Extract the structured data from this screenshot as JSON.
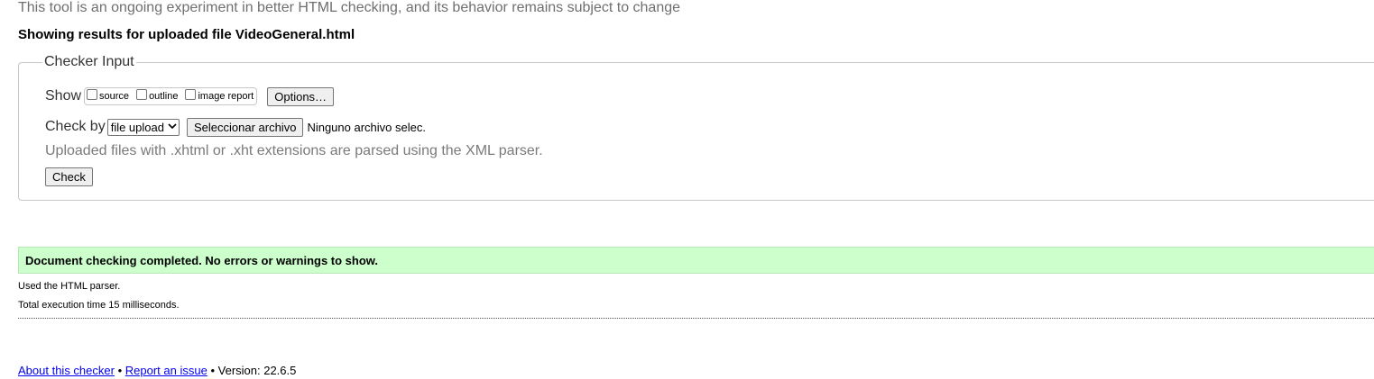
{
  "disclaimer": "This tool is an ongoing experiment in better HTML checking, and its behavior remains subject to change",
  "results_heading": "Showing results for uploaded file VideoGeneral.html",
  "checker_input": {
    "legend": "Checker Input",
    "show_label": "Show",
    "show_options": [
      {
        "label": "source",
        "checked": false
      },
      {
        "label": "outline",
        "checked": false
      },
      {
        "label": "image report",
        "checked": false
      }
    ],
    "options_button": "Options…",
    "check_by_label": "Check by",
    "check_by_selected": "file upload",
    "file_button": "Seleccionar archivo",
    "no_file_text": "Ninguno archivo selec.",
    "parser_note": "Uploaded files with .xhtml or .xht extensions are parsed using the XML parser.",
    "check_button": "Check"
  },
  "result": {
    "success_message": "Document checking completed. No errors or warnings to show.",
    "success_color": "#ccffcc",
    "parser_used": "Used the HTML parser.",
    "execution_time": "Total execution time 15 milliseconds."
  },
  "footer": {
    "about_link": "About this checker",
    "separator": "•",
    "report_link": "Report an issue",
    "version_text": "Version: 22.6.5"
  }
}
